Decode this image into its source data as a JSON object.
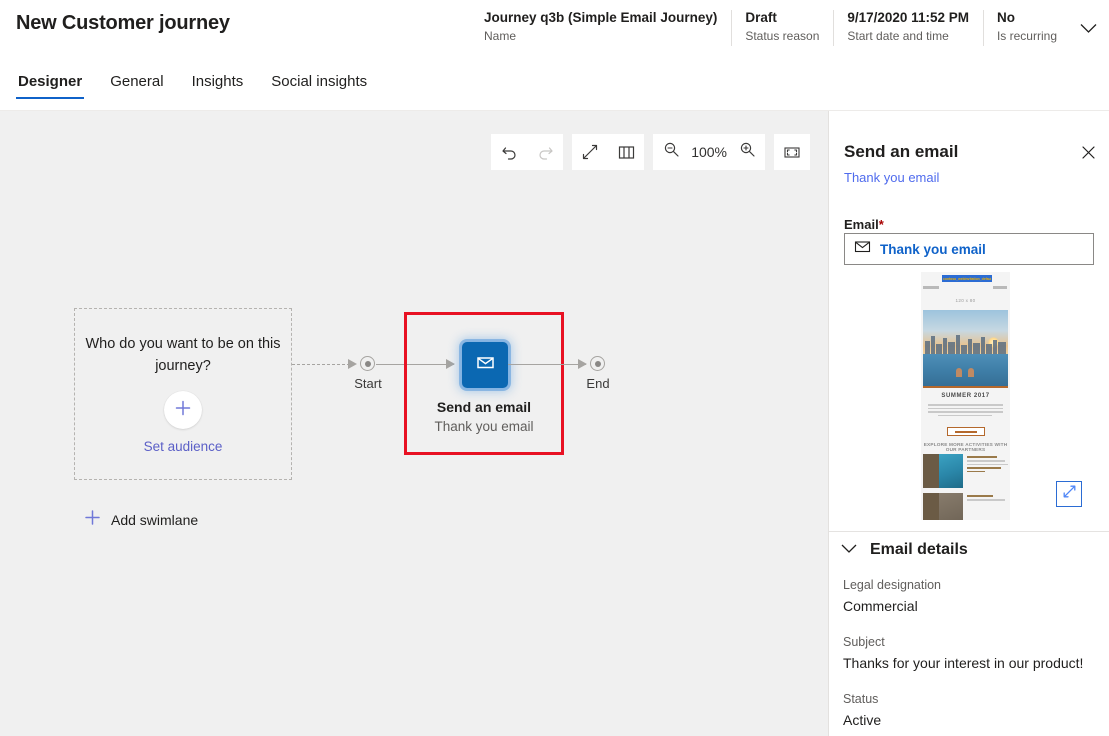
{
  "header": {
    "title": "New Customer journey",
    "fields": [
      {
        "value": "Journey q3b (Simple Email Journey)",
        "label": "Name"
      },
      {
        "value": "Draft",
        "label": "Status reason"
      },
      {
        "value": "9/17/2020 11:52 PM",
        "label": "Start date and time"
      },
      {
        "value": "No",
        "label": "Is recurring"
      }
    ],
    "expand_icon": "chevron-down-icon"
  },
  "tabs": [
    {
      "label": "Designer",
      "active": true
    },
    {
      "label": "General",
      "active": false
    },
    {
      "label": "Insights",
      "active": false
    },
    {
      "label": "Social insights",
      "active": false
    }
  ],
  "toolbar": {
    "undo": "undo-icon",
    "redo": "redo-icon",
    "expand": "expand-diagonal-icon",
    "map": "map-icon",
    "zoom_out": "zoom-out-icon",
    "zoom_level": "100%",
    "zoom_in": "zoom-in-icon",
    "fit": "fit-to-screen-icon"
  },
  "canvas": {
    "swimlane": {
      "question": "Who do you want to be on this journey?",
      "add_icon": "plus-icon",
      "link": "Set audience"
    },
    "add_swimlane": {
      "icon": "plus-icon",
      "label": "Add swimlane"
    },
    "start_node": "Start",
    "end_node": "End",
    "step": {
      "icon": "envelope-icon",
      "title": "Send an email",
      "subtitle": "Thank you email",
      "selected": true,
      "selection_color": "#e81123",
      "tile_color": "#0b68b2"
    }
  },
  "panel": {
    "title": "Send an email",
    "subtitle": "Thank you email",
    "close_icon": "close-icon",
    "field_label": "Email",
    "required_marker": "*",
    "email_value": "Thank you email",
    "email_icon": "envelope-icon",
    "preview": {
      "banner_text": "contoso_webinvitation_default",
      "placeholder_size": "120 x 80",
      "headline": "SUMMER 2017",
      "cta": "MORE INFO",
      "partners_heading": "EXPLORE MORE ACTIVITIES WITH OUR PARTNERS",
      "expand_icon": "expand-diagonal-icon"
    },
    "details": {
      "chevron_icon": "chevron-down-icon",
      "title": "Email details",
      "rows": [
        {
          "label": "Legal designation",
          "value": "Commercial"
        },
        {
          "label": "Subject",
          "value": "Thanks for your interest in our product!"
        },
        {
          "label": "Status",
          "value": "Active"
        }
      ]
    }
  },
  "colors": {
    "accent": "#0f62c9",
    "link": "#4f6bed",
    "selection": "#e81123",
    "tile": "#0b68b2",
    "canvas_bg": "#f0f0f0"
  }
}
